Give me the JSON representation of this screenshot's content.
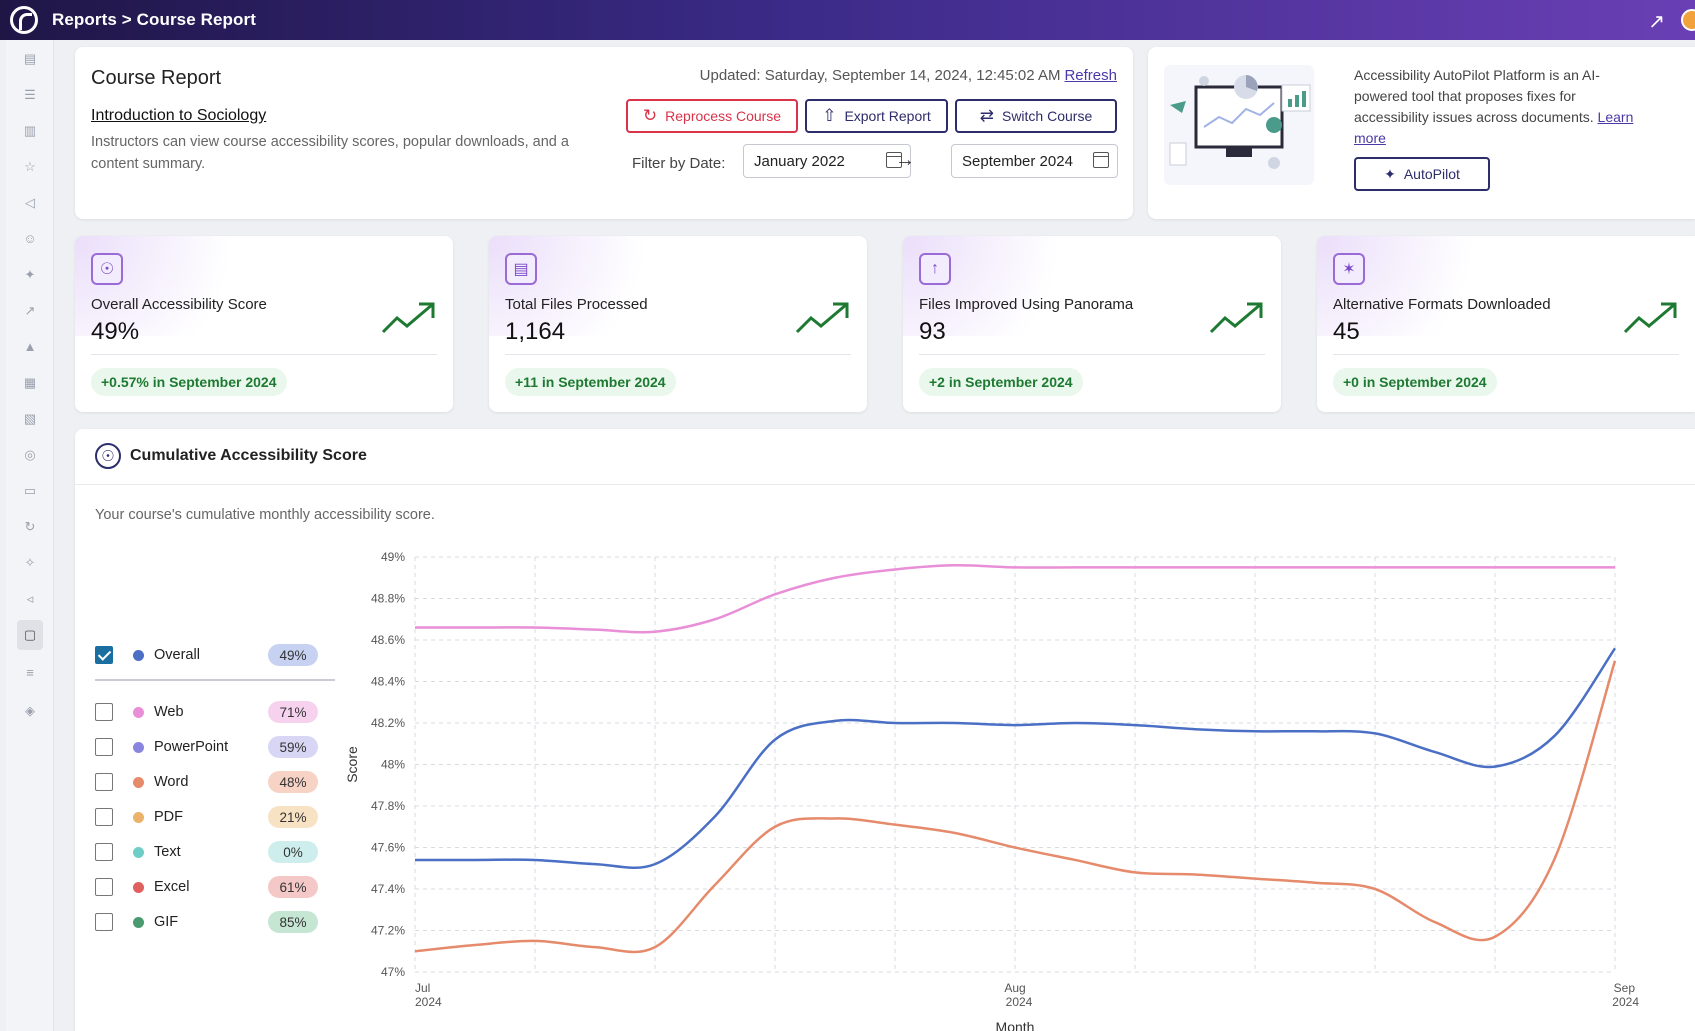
{
  "breadcrumb": "Reports > Course Report",
  "header": {
    "title": "Course Report",
    "course_name": "Introduction to Sociology",
    "description": "Instructors can view course accessibility scores, popular downloads, and a content summary.",
    "updated_prefix": "Updated: Saturday, September 14, 2024, 12:45:02 AM",
    "refresh_label": "Refresh",
    "reprocess_label": "Reprocess Course",
    "export_label": "Export Report",
    "switch_label": "Switch Course",
    "filter_label": "Filter by Date:",
    "date_from": "January 2022",
    "date_to": "September 2024"
  },
  "autopilot": {
    "text": "Accessibility AutoPilot Platform is an AI-powered tool that proposes fixes for accessibility issues across documents.",
    "learn_more": "Learn more",
    "button_label": "AutoPilot"
  },
  "stats": [
    {
      "label": "Overall Accessibility Score",
      "value": "49%",
      "delta": "+0.57% in September 2024",
      "icon": "accessibility-icon"
    },
    {
      "label": "Total Files Processed",
      "value": "1,164",
      "delta": "+11 in September 2024",
      "icon": "file-icon"
    },
    {
      "label": "Files Improved Using Panorama",
      "value": "93",
      "delta": "+2 in September 2024",
      "icon": "upload-icon"
    },
    {
      "label": "Alternative Formats Downloaded",
      "value": "45",
      "delta": "+0 in September 2024",
      "icon": "alt-format-icon"
    }
  ],
  "chart_section": {
    "title": "Cumulative Accessibility Score",
    "subtitle": "Your course's cumulative monthly accessibility score."
  },
  "legend": [
    {
      "name": "Overall",
      "value": "49%",
      "checked": true,
      "color": "#4a6fc4",
      "pill": "#c7d2f2"
    },
    {
      "name": "Web",
      "value": "71%",
      "checked": false,
      "color": "#e98fd8",
      "pill": "#f7d2ef"
    },
    {
      "name": "PowerPoint",
      "value": "59%",
      "checked": false,
      "color": "#8a86e0",
      "pill": "#d7d6f5"
    },
    {
      "name": "Word",
      "value": "48%",
      "checked": false,
      "color": "#e58a6a",
      "pill": "#f7d3c6"
    },
    {
      "name": "PDF",
      "value": "21%",
      "checked": false,
      "color": "#eab26a",
      "pill": "#f8e2c4"
    },
    {
      "name": "Text",
      "value": "0%",
      "checked": false,
      "color": "#6fcdc7",
      "pill": "#cdeeed"
    },
    {
      "name": "Excel",
      "value": "61%",
      "checked": false,
      "color": "#e06060",
      "pill": "#f5c8c8"
    },
    {
      "name": "GIF",
      "value": "85%",
      "checked": false,
      "color": "#4a9a70",
      "pill": "#c6e6d4"
    }
  ],
  "chart_data": {
    "type": "line",
    "xlabel": "Month",
    "ylabel": "Score",
    "ylim": [
      47,
      49
    ],
    "yticks": [
      "47%",
      "47.2%",
      "47.4%",
      "47.6%",
      "47.8%",
      "48%",
      "48.2%",
      "48.4%",
      "48.6%",
      "48.8%",
      "49%"
    ],
    "xticks": [
      {
        "pos": 0,
        "line1": "Jul",
        "line2": "2024"
      },
      {
        "pos": 0.5,
        "line1": "Aug",
        "line2": "2024"
      },
      {
        "pos": 1,
        "line1": "Sep",
        "line2": "2024"
      }
    ],
    "x": [
      0,
      0.05,
      0.1,
      0.15,
      0.2,
      0.25,
      0.3,
      0.35,
      0.4,
      0.45,
      0.5,
      0.55,
      0.6,
      0.65,
      0.7,
      0.75,
      0.8,
      0.85,
      0.9,
      0.95,
      1.0
    ],
    "series": [
      {
        "color": "#e98fd8",
        "values": [
          48.66,
          48.66,
          48.66,
          48.65,
          48.64,
          48.7,
          48.82,
          48.9,
          48.94,
          48.96,
          48.95,
          48.95,
          48.95,
          48.95,
          48.95,
          48.95,
          48.95,
          48.95,
          48.95,
          48.95,
          48.95
        ]
      },
      {
        "color": "#4a6fc4",
        "values": [
          47.54,
          47.54,
          47.54,
          47.52,
          47.52,
          47.75,
          48.12,
          48.21,
          48.2,
          48.2,
          48.19,
          48.2,
          48.19,
          48.17,
          48.16,
          48.16,
          48.15,
          48.06,
          47.99,
          48.14,
          48.56
        ]
      },
      {
        "color": "#e58a6a",
        "values": [
          47.1,
          47.13,
          47.15,
          47.12,
          47.12,
          47.42,
          47.7,
          47.74,
          47.71,
          47.67,
          47.6,
          47.54,
          47.48,
          47.47,
          47.45,
          47.43,
          47.4,
          47.24,
          47.17,
          47.55,
          48.5
        ]
      }
    ]
  }
}
